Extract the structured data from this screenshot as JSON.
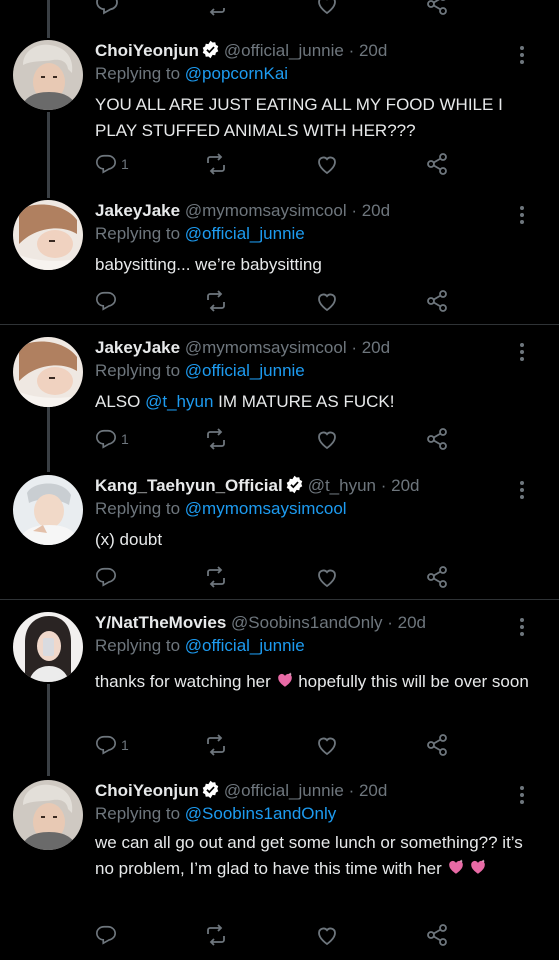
{
  "tweets": [
    {
      "name": "ChoiYeonjun",
      "verified": true,
      "handle": "@official_junnie",
      "time": "20d",
      "reply_label": "Replying to",
      "reply_to": "@popcornKai",
      "text": "YOU ALL ARE JUST EATING ALL MY FOOD WHILE I PLAY STUFFED ANIMALS WITH HER???",
      "reply_count": "1"
    },
    {
      "name": "JakeyJake",
      "verified": false,
      "handle": "@mymomsaysimcool",
      "time": "20d",
      "reply_label": "Replying to",
      "reply_to": "@official_junnie",
      "text": "babysitting... we’re babysitting",
      "reply_count": ""
    },
    {
      "name": "JakeyJake",
      "verified": false,
      "handle": "@mymomsaysimcool",
      "time": "20d",
      "reply_label": "Replying to",
      "reply_to": "@official_junnie",
      "text_before": "ALSO ",
      "text_mention": "@t_hyun",
      "text_after": " IM MATURE AS FUCK!",
      "reply_count": "1"
    },
    {
      "name": "Kang_Taehyun_Official",
      "verified": true,
      "handle": "@t_hyun",
      "time": "20d",
      "reply_label": "Replying to",
      "reply_to": "@mymomsaysimcool",
      "text": "(x) doubt",
      "reply_count": ""
    },
    {
      "name": "Y/NatTheMovies",
      "verified": false,
      "handle": "@Soobins1andOnly",
      "time": "20d",
      "reply_label": "Replying to",
      "reply_to": "@official_junnie",
      "text_before": "thanks for watching her",
      "text_after": " hopefully this will be over soon",
      "reply_count": "1"
    },
    {
      "name": "ChoiYeonjun",
      "verified": true,
      "handle": "@official_junnie",
      "time": "20d",
      "reply_label": "Replying to",
      "reply_to": "@Soobins1andOnly",
      "text": "we can all go out and get some lunch or something?? it’s no problem, I’m glad to have this time with her",
      "reply_count": ""
    }
  ],
  "colors": {
    "background": "#000000",
    "text": "#e7e9ea",
    "muted": "#6e767d",
    "link": "#1d9bf0",
    "verified": "#ffffff",
    "emoji_heart": "#e86aa5"
  },
  "icons": [
    "reply-icon",
    "retweet-icon",
    "like-icon",
    "share-icon",
    "more-icon",
    "verified-badge-icon",
    "sparkling-heart-emoji"
  ]
}
